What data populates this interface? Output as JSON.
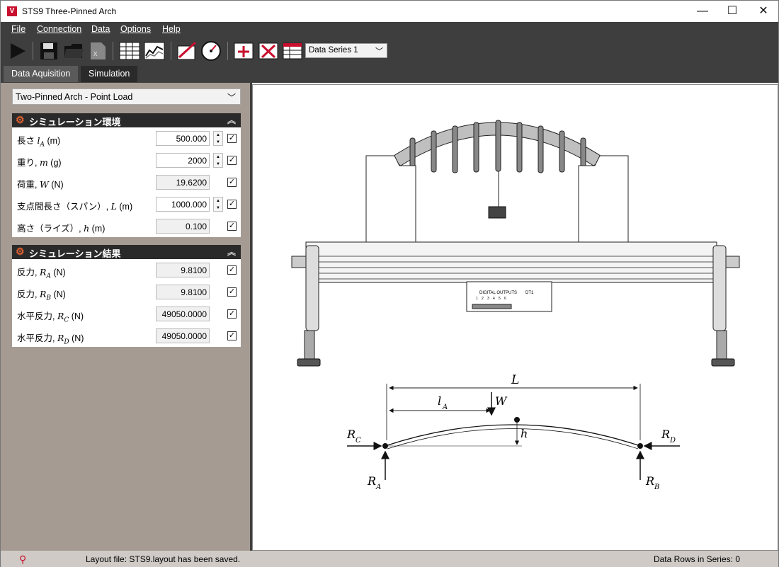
{
  "window": {
    "icon_letter": "V",
    "title": "STS9 Three-Pinned Arch",
    "minimize": "—",
    "maximize": "☐",
    "close": "✕"
  },
  "menu": [
    "File",
    "Connection",
    "Data",
    "Options",
    "Help"
  ],
  "toolbar": {
    "icons": [
      "play-icon",
      "save-icon",
      "open-folder-icon",
      "excel-export-icon",
      "table-view-icon",
      "chart-view-icon",
      "calibrate-icon",
      "gauge-icon",
      "add-row-icon",
      "delete-row-icon",
      "clear-table-icon"
    ],
    "series_select": "Data Series 1"
  },
  "tabs": [
    "Data Aquisition",
    "Simulation"
  ],
  "model": "Two-Pinned Arch - Point Load",
  "environment": {
    "header": "シミュレーション環境",
    "rows": [
      {
        "label": "長さ l_A (m)",
        "value": "500.000",
        "editable": true
      },
      {
        "label": "重り, m (g)",
        "value": "2000",
        "editable": true
      },
      {
        "label": "荷重, W (N)",
        "value": "19.6200",
        "editable": false
      },
      {
        "label": "支点間長さ（スパン）, L (m)",
        "value": "1000.000",
        "editable": true
      },
      {
        "label": "高さ（ライズ）, h (m)",
        "value": "0.100",
        "editable": false
      }
    ]
  },
  "results": {
    "header": "シミュレーション結果",
    "rows": [
      {
        "label": "反力, R_A (N)",
        "value": "9.8100"
      },
      {
        "label": "反力, R_B (N)",
        "value": "9.8100"
      },
      {
        "label": "水平反力, R_C (N)",
        "value": "49050.0000"
      },
      {
        "label": "水平反力, R_D (N)",
        "value": "49050.0000"
      }
    ]
  },
  "diagram": {
    "device_text": "DIGITAL OUTPUTS",
    "device_ports": [
      "1",
      "2",
      "3",
      "4",
      "5",
      "6"
    ],
    "device_label": "DT1",
    "labels": {
      "L": "L",
      "lA": "l",
      "lA_sub": "A",
      "W": "W",
      "h": "h",
      "RC": "R",
      "RC_sub": "C",
      "RD": "R",
      "RD_sub": "D",
      "RA": "R",
      "RA_sub": "A",
      "RB": "R",
      "RB_sub": "B"
    }
  },
  "status": {
    "message": "Layout file: STS9.layout has been saved.",
    "rows": "Data Rows in Series: 0"
  }
}
